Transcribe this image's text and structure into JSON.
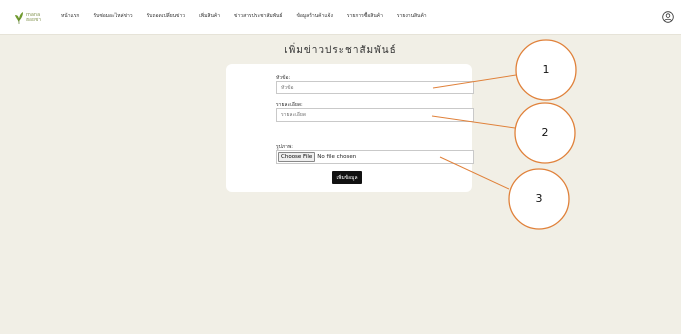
{
  "header": {
    "logo_text": "mana\nฮอยชา",
    "nav": [
      "หน้าแรก",
      "รับซ่อมอะไหล่ข่าว",
      "รับถอดเปลี่ยนข่าว",
      "เพิ่มสินค้า",
      "ข่าวสารประชาสัมพันธ์",
      "ข้อมูลร้านค้าแจ้ง",
      "รายการซื้อสินค้า",
      "รายงานสินค้า"
    ],
    "user_icon": "user-circle-icon"
  },
  "page": {
    "title": "เพิ่มข่าวประชาสัมพันธ์"
  },
  "form": {
    "title_label": "หัวข้อ:",
    "title_placeholder": "หัวข้อ",
    "detail_label": "รายละเอียด:",
    "detail_placeholder": "รายละเอียด",
    "image_label": "รูปภาพ:",
    "file_button": "Choose File",
    "file_status": "No file chosen",
    "submit_label": "เพิ่มข้อมูล"
  },
  "annotations": [
    "1",
    "2",
    "3"
  ],
  "colors": {
    "background": "#f1efe6",
    "accent_leaf": "#6f9a2e",
    "annotation_line": "#e0813a"
  }
}
